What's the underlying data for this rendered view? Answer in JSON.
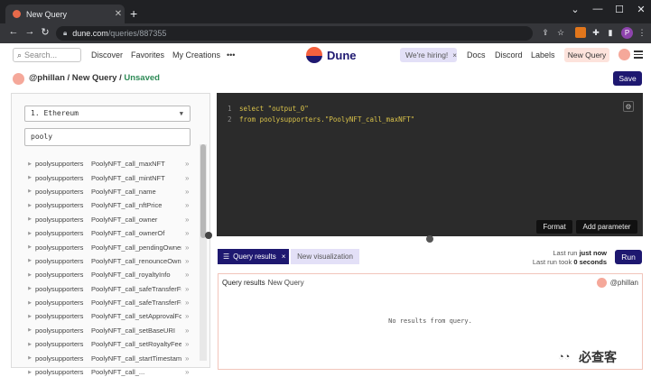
{
  "browser": {
    "tab_title": "New Query",
    "tab_close": "✕",
    "new_tab": "+",
    "url_domain": "dune.com",
    "url_path": "/queries/887355",
    "profile_initial": "P",
    "window_controls": [
      "⌄",
      "—",
      "☐",
      "✕"
    ]
  },
  "header": {
    "search_placeholder": "Search...",
    "nav": [
      "Discover",
      "Favorites",
      "My Creations",
      "•••"
    ],
    "logo_text": "Dune",
    "hiring_label": "We're hiring!",
    "hiring_close": "×",
    "links": [
      "Docs",
      "Discord",
      "Labels"
    ],
    "new_query": "New Query",
    "brand_colors": {
      "orange": "#f4603e",
      "navy": "#1e1870"
    }
  },
  "crumb": {
    "user": "@phillan",
    "sep1": " / ",
    "page": "New Query",
    "sep2": " / ",
    "status": "Unsaved",
    "save_label": "Save"
  },
  "explorer": {
    "chain": "1. Ethereum",
    "filter_value": "pooly",
    "schema": "poolysupporters",
    "tables": [
      "PoolyNFT_call_maxNFT",
      "PoolyNFT_call_mintNFT",
      "PoolyNFT_call_name",
      "PoolyNFT_call_nftPrice",
      "PoolyNFT_call_owner",
      "PoolyNFT_call_ownerOf",
      "PoolyNFT_call_pendingOwner",
      "PoolyNFT_call_renounceOwn...",
      "PoolyNFT_call_royaltyInfo",
      "PoolyNFT_call_safeTransferFr...",
      "PoolyNFT_call_safeTransferFr...",
      "PoolyNFT_call_setApprovalFo...",
      "PoolyNFT_call_setBaseURI",
      "PoolyNFT_call_setRoyaltyFee",
      "PoolyNFT_call_startTimestamp",
      "PoolyNFT_call_..."
    ]
  },
  "editor": {
    "lines": [
      {
        "num": "1",
        "kw": "select",
        "rest": " \"output_0\""
      },
      {
        "num": "2",
        "kw": "from",
        "rest": " poolysupporters.\"PoolyNFT_call_maxNFT\""
      }
    ],
    "format_label": "Format",
    "add_param_label": "Add parameter"
  },
  "results": {
    "tab_results": "Query results",
    "tab_close": "×",
    "tab_new_viz": "New visualization",
    "last_run_label": "Last run",
    "last_run_value": "just now",
    "last_run_took_label": "Last run took",
    "last_run_took_value": "0 seconds",
    "run_label": "Run",
    "panel_title": "Query results",
    "panel_subtitle": "New Query",
    "panel_user": "@phillan",
    "empty_message": "No results from query."
  },
  "watermark": "必查客"
}
